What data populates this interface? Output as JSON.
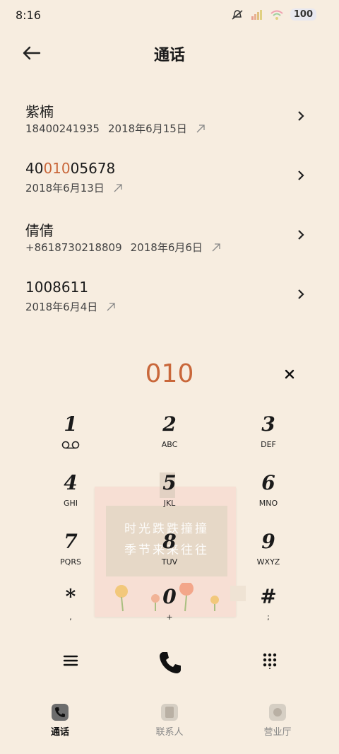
{
  "status_bar": {
    "time": "8:16",
    "battery": "100",
    "icons": [
      "mute-icon",
      "signal-icon",
      "wifi-icon",
      "battery-icon"
    ]
  },
  "header": {
    "title": "通话"
  },
  "calls": [
    {
      "name": "紫楠",
      "number": "18400241935",
      "date": "2018年6月15日"
    },
    {
      "name_pre": "40",
      "name_hl": "010",
      "name_post": "05678",
      "date": "2018年6月13日"
    },
    {
      "name": "倩倩",
      "number": "+8618730218809",
      "date": "2018年6月6日"
    },
    {
      "name": "1008611",
      "date": "2018年6月4日"
    }
  ],
  "dial_input": "010",
  "keypad": [
    {
      "digit": "1",
      "letters": "voicemail"
    },
    {
      "digit": "2",
      "letters": "ABC"
    },
    {
      "digit": "3",
      "letters": "DEF"
    },
    {
      "digit": "4",
      "letters": "GHI"
    },
    {
      "digit": "5",
      "letters": "JKL"
    },
    {
      "digit": "6",
      "letters": "MNO"
    },
    {
      "digit": "7",
      "letters": "PQRS"
    },
    {
      "digit": "8",
      "letters": "TUV"
    },
    {
      "digit": "9",
      "letters": "WXYZ"
    },
    {
      "digit": "*",
      "letters": ","
    },
    {
      "digit": "0",
      "letters": "+"
    },
    {
      "digit": "#",
      "letters": ";"
    }
  ],
  "sticker": {
    "line1": "时光跌跌撞撞",
    "line2": "季节来来往往"
  },
  "bottom_nav": [
    {
      "label": "通话",
      "active": true
    },
    {
      "label": "联系人",
      "active": false
    },
    {
      "label": "营业厅",
      "active": false
    }
  ],
  "colors": {
    "background": "#f7ede0",
    "accent": "#c9673a"
  }
}
